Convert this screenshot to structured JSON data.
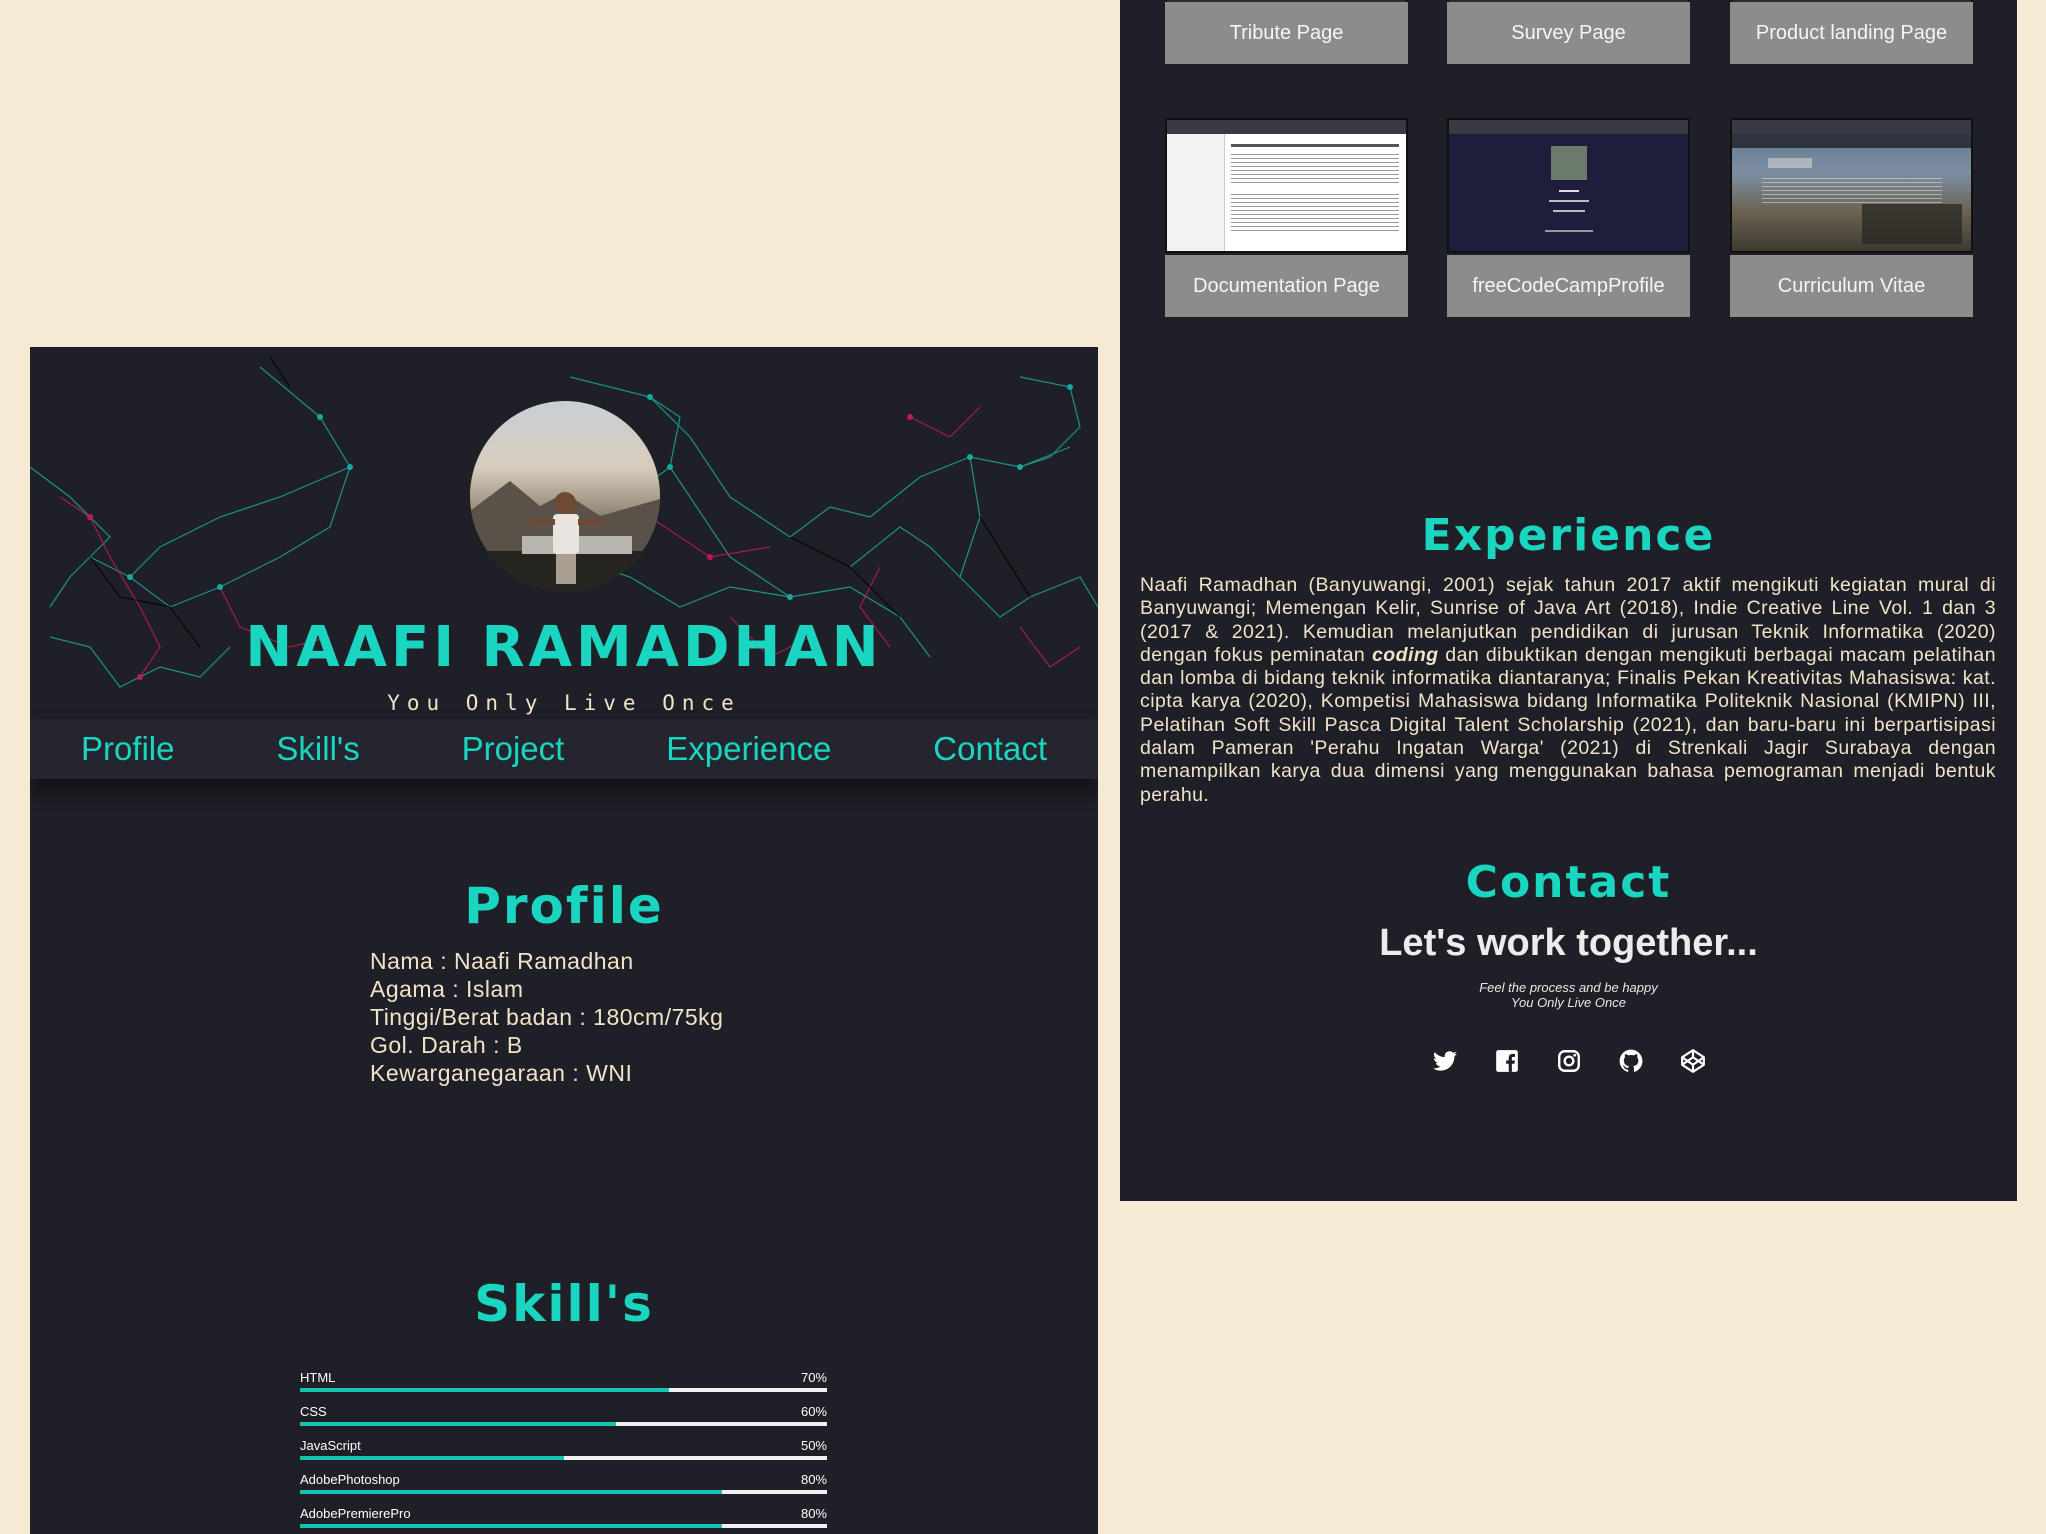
{
  "hero": {
    "name": "NAAFI RAMADHAN",
    "tagline": "You Only Live Once"
  },
  "nav": {
    "items": [
      "Profile",
      "Skill's",
      "Project",
      "Experience",
      "Contact"
    ]
  },
  "profile": {
    "title": "Profile",
    "lines": [
      "Nama : Naafi Ramadhan",
      "Agama : Islam",
      "Tinggi/Berat badan : 180cm/75kg",
      "Gol. Darah : B",
      "Kewarganegaraan : WNI"
    ]
  },
  "skills": {
    "title": "Skill's",
    "items": [
      {
        "name": "HTML",
        "percent_label": "70%",
        "value": 0.7
      },
      {
        "name": "CSS",
        "percent_label": "60%",
        "value": 0.6
      },
      {
        "name": "JavaScript",
        "percent_label": "50%",
        "value": 0.5
      },
      {
        "name": "AdobePhotoshop",
        "percent_label": "80%",
        "value": 0.8
      },
      {
        "name": "AdobePremierePro",
        "percent_label": "80%",
        "value": 0.8
      }
    ]
  },
  "projects": {
    "row1": [
      "Tribute Page",
      "Survey Page",
      "Product landing Page"
    ],
    "row2": [
      "Documentation Page",
      "freeCodeCampProfile",
      "Curriculum Vitae"
    ]
  },
  "experience": {
    "title": "Experience",
    "text_before": "Naafi Ramadhan (Banyuwangi, 2001) sejak tahun 2017 aktif mengikuti kegiatan mural di Banyuwangi; Memengan Kelir, Sunrise of Java Art (2018), Indie Creative Line Vol. 1 dan 3 (2017 & 2021). Kemudian melanjutkan pendidikan di jurusan Teknik Informatika (2020) dengan fokus peminatan ",
    "text_emphasis": "coding",
    "text_after": " dan dibuktikan dengan mengikuti berbagai macam pelatihan dan lomba di bidang teknik informatika diantaranya; Finalis Pekan Kreativitas Mahasiswa: kat. cipta karya (2020), Kompetisi Mahasiswa bidang Informatika Politeknik Nasional (KMIPN) III, Pelatihan Soft Skill Pasca Digital Talent Scholarship (2021), dan baru-baru ini berpartisipasi dalam Pameran 'Perahu Ingatan Warga' (2021) di Strenkali Jagir Surabaya dengan menampilkan karya dua dimensi yang menggunakan bahasa pemograman menjadi bentuk perahu."
  },
  "contact": {
    "title": "Contact",
    "headline": "Let's work together...",
    "sub1": "Feel the process and be happy",
    "sub2": "You Only Live Once",
    "social_icons": [
      "twitter-icon",
      "facebook-icon",
      "instagram-icon",
      "github-icon",
      "codepen-icon"
    ]
  },
  "colors": {
    "accent": "#1ad6c0",
    "panel_bg": "#1f1f27",
    "page_bg": "#f6ead4",
    "text_cream": "#f1e3c8",
    "card_label_bg": "#8c8c8c"
  }
}
